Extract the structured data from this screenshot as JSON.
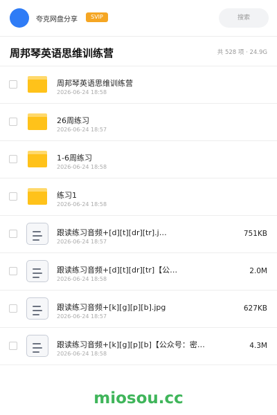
{
  "header": {
    "share_label": "夸克网盘分享",
    "svip_badge": "SVIP",
    "search_label": "搜索"
  },
  "folder": {
    "title": "周邦琴英语思维训练营",
    "summary": "共 528 项 · 24.9G"
  },
  "items": [
    {
      "type": "folder",
      "name": "周邦琴英语思维训练营",
      "date": "2026-06-24 18:58",
      "size": ""
    },
    {
      "type": "folder",
      "name": "26周练习",
      "date": "2026-06-24 18:57",
      "size": ""
    },
    {
      "type": "folder",
      "name": "1-6周练习",
      "date": "2026-06-24 18:58",
      "size": ""
    },
    {
      "type": "folder",
      "name": "练习1",
      "date": "2026-06-24 18:58",
      "size": ""
    },
    {
      "type": "file",
      "name": "跟读练习音频+[d][t][dr][tr].j…",
      "date": "2026-06-24 18:57",
      "size": "751KB"
    },
    {
      "type": "file",
      "name": "跟读练习音频+[d][t][dr][tr]【公…",
      "date": "2026-06-24 18:58",
      "size": "2.0M"
    },
    {
      "type": "file",
      "name": "跟读练习音频+[k][g][p][b].jpg",
      "date": "2026-06-24 18:57",
      "size": "627KB"
    },
    {
      "type": "file",
      "name": "跟读练习音频+[k][g][p][b]【公众号：密…",
      "date": "2026-06-24 18:58",
      "size": "4.3M"
    }
  ],
  "watermark": "miosou.cc",
  "colors": {
    "avatar": "#2f7cf6",
    "svip": "#f5a623",
    "folder": "#ffc21a",
    "watermark": "#3fb55a"
  }
}
